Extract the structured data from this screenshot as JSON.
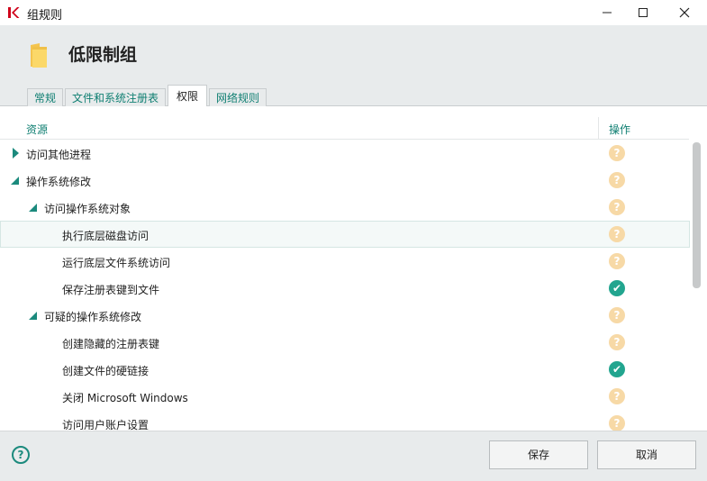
{
  "window": {
    "title": "组规则"
  },
  "header": {
    "title": "低限制组"
  },
  "tabs": [
    {
      "label": "常规",
      "active": false
    },
    {
      "label": "文件和系统注册表",
      "active": false
    },
    {
      "label": "权限",
      "active": true
    },
    {
      "label": "网络规则",
      "active": false
    }
  ],
  "table": {
    "col_resource": "资源",
    "col_action": "操作",
    "rows": [
      {
        "label": "访问其他进程",
        "level": 0,
        "expander": "collapsed",
        "status": "question"
      },
      {
        "label": "操作系统修改",
        "level": 0,
        "expander": "expanded",
        "status": "question"
      },
      {
        "label": "访问操作系统对象",
        "level": 1,
        "expander": "expanded",
        "status": "question"
      },
      {
        "label": "执行底层磁盘访问",
        "level": 2,
        "expander": "none",
        "status": "question",
        "highlighted": true
      },
      {
        "label": "运行底层文件系统访问",
        "level": 2,
        "expander": "none",
        "status": "question"
      },
      {
        "label": "保存注册表键到文件",
        "level": 2,
        "expander": "none",
        "status": "allowed"
      },
      {
        "label": "可疑的操作系统修改",
        "level": 1,
        "expander": "expanded",
        "status": "question"
      },
      {
        "label": "创建隐藏的注册表键",
        "level": 2,
        "expander": "none",
        "status": "question"
      },
      {
        "label": "创建文件的硬链接",
        "level": 2,
        "expander": "none",
        "status": "allowed"
      },
      {
        "label": "关闭 Microsoft Windows",
        "level": 2,
        "expander": "none",
        "status": "question"
      },
      {
        "label": "访问用户账户设置",
        "level": 2,
        "expander": "none",
        "status": "question"
      }
    ]
  },
  "footer": {
    "save_label": "保存",
    "cancel_label": "取消"
  },
  "icons": {
    "question_glyph": "?",
    "allowed_glyph": "✔",
    "help_glyph": "?"
  },
  "colors": {
    "accent": "#1b8a7d",
    "question": "#f7d9a6",
    "allowed": "#22a58f",
    "brand_red": "#d0021b"
  }
}
